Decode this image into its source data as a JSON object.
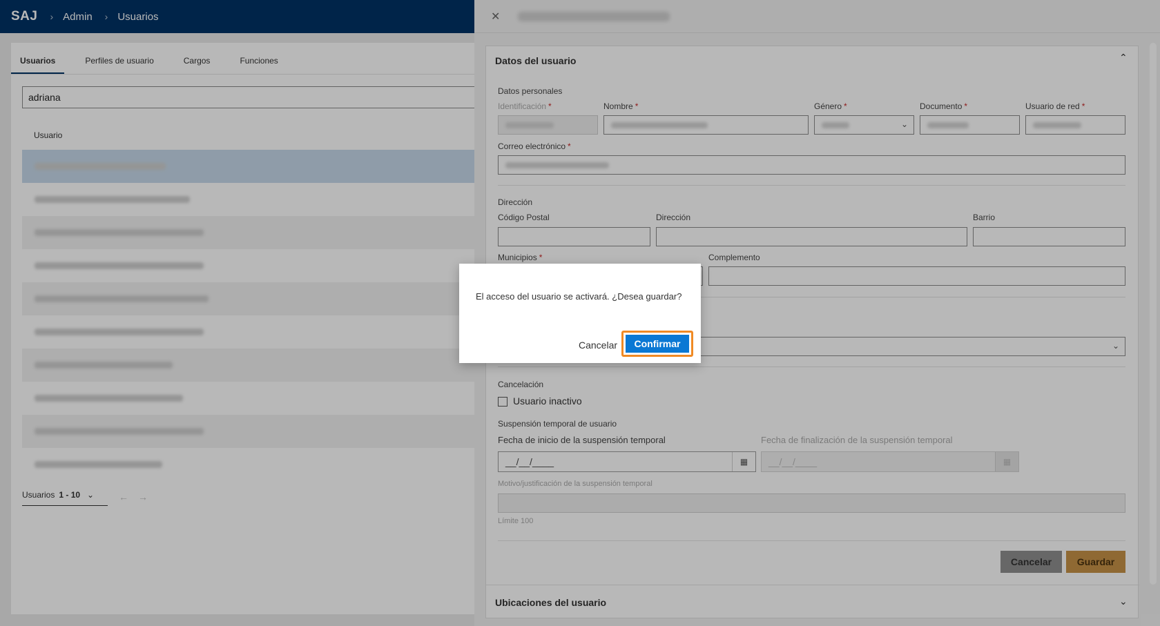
{
  "app": {
    "logo": "SAJ",
    "breadcrumb": [
      "Admin",
      "Usuarios"
    ]
  },
  "tabs": [
    "Usuarios",
    "Perfiles de usuario",
    "Cargos",
    "Funciones"
  ],
  "search": {
    "value": "adriana"
  },
  "table": {
    "column": "Usuario",
    "row_count": 10
  },
  "pager": {
    "label": "Usuarios",
    "range": "1 - 10"
  },
  "panel": {
    "section_user": "Datos del usuario",
    "group_personal": "Datos personales",
    "labels": {
      "identificacion": "Identificación",
      "nombre": "Nombre",
      "genero": "Género",
      "documento": "Documento",
      "usuario_red": "Usuario de red",
      "correo": "Correo electrónico"
    },
    "group_address": "Dirección",
    "address_labels": {
      "codigo_postal": "Código Postal",
      "direccion": "Dirección",
      "barrio": "Barrio",
      "municipios": "Municipios",
      "complemento": "Complemento"
    },
    "group_cancel": "Cancelación",
    "inactive_label": "Usuario inactivo",
    "group_suspension": "Suspensión temporal de usuario",
    "date_start_label": "Fecha de inicio de la suspensión temporal",
    "date_end_label": "Fecha de finalización de la suspensión temporal",
    "date_placeholder": "__/__/____",
    "reason_label": "Motivo/justificación de la suspensión temporal",
    "limit": "Límite 100",
    "cancel_button": "Cancelar",
    "save_button": "Guardar",
    "section_locations": "Ubicaciones del usuario"
  },
  "dialog": {
    "message": "El acceso del usuario se activará. ¿Desea guardar?",
    "cancel": "Cancelar",
    "confirm": "Confirmar"
  },
  "colors": {
    "topbar": "#003366",
    "confirm": "#0a78d4",
    "confirm_outline": "#f08a24",
    "save": "#c79247"
  }
}
